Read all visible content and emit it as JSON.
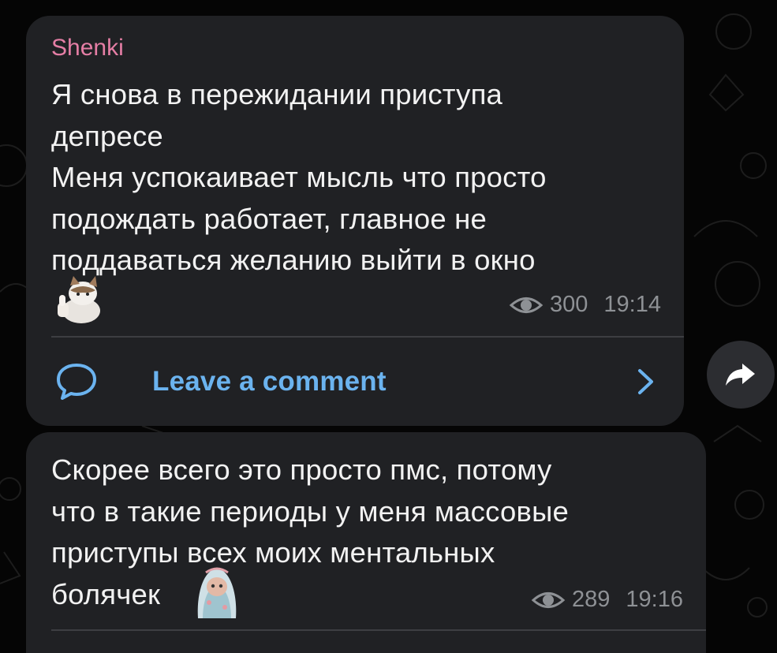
{
  "posts": [
    {
      "sender": "Shenki",
      "text": "Я снова в пережидании приступа\nдепресе\nМеня успокаивает мысль что просто\nподождать работает, главное не\nподдаваться желанию выйти в окно",
      "sticker": "cat-thumbs-up-sticker",
      "views": "300",
      "time": "19:14",
      "comment_label": "Leave a comment"
    },
    {
      "text": "Скорее всего это просто пмс, потому\nчто в такие периоды у меня массовые\nприступы всех моих ментальных\nболячек",
      "sticker": "cat-blanket-sticker",
      "views": "289",
      "time": "19:16"
    }
  ],
  "icons": {
    "views": "eye-icon",
    "comment": "speech-bubble-icon",
    "open_comments": "chevron-right-icon",
    "share": "share-arrow-icon"
  },
  "colors": {
    "background": "#050505",
    "bubble": "#202124",
    "sender": "#e57ea5",
    "link": "#6bb3ef",
    "meta": "#8e9195"
  }
}
